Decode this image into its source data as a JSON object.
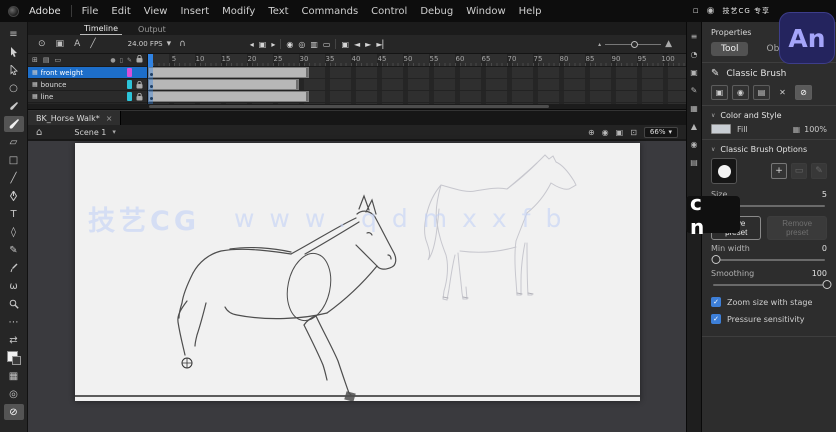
{
  "menubar": {
    "brand": "Adobe",
    "items": [
      "File",
      "Edit",
      "View",
      "Insert",
      "Modify",
      "Text",
      "Commands",
      "Control",
      "Debug",
      "Window",
      "Help"
    ]
  },
  "window": {
    "badge": "An",
    "corner_watermark": "技艺CG 专享"
  },
  "toolbar": {
    "tools": [
      {
        "n": "panel-handle-icon",
        "g": "≡",
        "interact": false
      },
      {
        "n": "selection-tool",
        "g": "@arrow"
      },
      {
        "n": "subselection-tool",
        "g": "@darrow"
      },
      {
        "n": "lasso-tool",
        "g": "○"
      },
      {
        "n": "fluid-brush-tool",
        "g": "@brush"
      },
      {
        "n": "classic-brush-tool",
        "g": "@brushbig",
        "active": true
      },
      {
        "n": "eraser-tool",
        "g": "▱"
      },
      {
        "n": "rectangle-tool",
        "g": "□"
      },
      {
        "n": "line-tool",
        "g": "╱"
      },
      {
        "n": "pen-tool",
        "g": "@pen"
      },
      {
        "n": "text-tool",
        "g": "T"
      },
      {
        "n": "paint-bucket-tool",
        "g": "◊"
      },
      {
        "n": "pencil-tool",
        "g": "✎"
      },
      {
        "n": "eyedropper-tool",
        "g": "@eyedrop"
      },
      {
        "n": "hand-tool",
        "g": "ω"
      },
      {
        "n": "zoom-tool",
        "g": "@zoomglass"
      },
      {
        "n": "more-tools-icon",
        "g": "⋯"
      },
      {
        "n": "swap-colors-icon",
        "g": "⇄"
      },
      {
        "n": "stroke-fill-swatches",
        "g": "@swatches"
      },
      {
        "n": "grid-snap-icon",
        "g": "▦"
      },
      {
        "n": "outline-mode-icon",
        "g": "◎"
      },
      {
        "n": "no-color-icon",
        "g": "⊘",
        "active": true
      }
    ]
  },
  "timeline": {
    "tabs": [
      {
        "label": "Timeline",
        "active": true
      },
      {
        "label": "Output",
        "active": false
      }
    ],
    "left_icons": [
      {
        "n": "show-layers-eye-icon",
        "g": "⊙"
      },
      {
        "n": "camera-layer-icon",
        "g": "▣"
      },
      {
        "n": "advanced-layers-icon",
        "g": "A"
      },
      {
        "n": "graph-editor-icon",
        "g": "╱"
      }
    ],
    "fps": "24.00 FPS",
    "fps_caret": "▾",
    "magnet": "∩",
    "playback": [
      {
        "n": "prev-frame-button",
        "g": "◂"
      },
      {
        "n": "current-frame-button",
        "g": "▣"
      },
      {
        "n": "next-frame-button",
        "g": "▸"
      },
      {
        "n": "sep",
        "g": "|"
      },
      {
        "n": "onion-skin-button",
        "g": "◉"
      },
      {
        "n": "onion-outlines-button",
        "g": "◎"
      },
      {
        "n": "edit-multiple-frames-button",
        "g": "▥"
      },
      {
        "n": "loop-button",
        "g": "▭"
      },
      {
        "n": "sep",
        "g": "|"
      },
      {
        "n": "camera-button",
        "g": "▣"
      },
      {
        "n": "step-back-button",
        "g": "◄"
      },
      {
        "n": "play-button",
        "g": "►"
      },
      {
        "n": "step-forward-button",
        "g": "►▏"
      }
    ],
    "layer_controls": [
      {
        "n": "new-layer-button",
        "g": "⊞"
      },
      {
        "n": "new-folder-button",
        "g": "▤"
      },
      {
        "n": "delete-layer-button",
        "g": "▭"
      }
    ],
    "column_icons": [
      {
        "n": "dot-column-icon",
        "g": "●"
      },
      {
        "n": "outline-column-icon",
        "g": "▯"
      },
      {
        "n": "highlight-column-icon",
        "g": "✎"
      },
      {
        "n": "lock-column-icon",
        "g": "@lock"
      }
    ],
    "ruler_numbers": [
      5,
      10,
      15,
      20,
      25,
      30,
      35,
      40,
      45,
      50,
      55,
      60,
      65,
      70,
      75,
      80,
      85,
      90,
      95,
      100
    ],
    "layers": [
      {
        "name": "front weight",
        "color": "#d94fd9",
        "selected": true,
        "locked": false,
        "span_frames": 31
      },
      {
        "name": "bounce",
        "color": "#2cc4d9",
        "selected": false,
        "locked": true,
        "span_frames": 29
      },
      {
        "name": "line",
        "color": "#2cc4d9",
        "selected": false,
        "locked": true,
        "span_frames": 31
      }
    ],
    "playhead_frame": 1
  },
  "document": {
    "tab_title": "BK_Horse Walk*",
    "close": "×",
    "scene": "Scene 1",
    "scene_caret": "▾",
    "zoom_level": "66%",
    "editbar_icons": [
      {
        "n": "center-frame-icon",
        "g": "⊕"
      },
      {
        "n": "camera-icon",
        "g": "◉"
      },
      {
        "n": "edit-symbols-icon",
        "g": "▣"
      },
      {
        "n": "fit-to-window-icon",
        "g": "⊡"
      }
    ]
  },
  "watermark": {
    "brand": "技艺CG",
    "url": "www.qdmxxfb",
    "suffix": "c n"
  },
  "dock": {
    "icons": [
      {
        "n": "align-panel-icon",
        "g": "≡"
      },
      {
        "n": "history-panel-icon",
        "g": "◔"
      },
      {
        "n": "library-panel-icon",
        "g": "▣"
      },
      {
        "n": "brushes-panel-icon",
        "g": "✎"
      },
      {
        "n": "swatches-panel-icon",
        "g": "▦"
      },
      {
        "n": "transform-panel-icon",
        "g": "▲"
      },
      {
        "n": "color-panel-icon",
        "g": "◉"
      },
      {
        "n": "components-panel-icon",
        "g": "▤"
      }
    ]
  },
  "properties": {
    "title": "Properties",
    "tabs": [
      {
        "label": "Tool",
        "active": true
      },
      {
        "label": "Object",
        "active": false
      }
    ],
    "tool_name": "Classic Brush",
    "option_buttons": [
      {
        "n": "object-drawing-button",
        "g": "▣"
      },
      {
        "n": "brush-library-button",
        "g": "◉"
      },
      {
        "n": "paint-mode-button",
        "g": "▤"
      },
      {
        "n": "pressure-button",
        "g": "✕",
        "noborder": true
      },
      {
        "n": "tilt-button",
        "g": "⊘",
        "active": true
      }
    ],
    "color_section": "Color and Style",
    "fill_label": "Fill",
    "fill_alpha": "100%",
    "brush_section": "Classic Brush Options",
    "size_label": "Size",
    "size_value": "5",
    "size_percent": 6,
    "save_preset": "Save preset",
    "remove_preset": "Remove preset",
    "minwidth_label": "Min width",
    "minwidth_value": "0",
    "minwidth_percent": 4,
    "smoothing_label": "Smoothing",
    "smoothing_value": "100",
    "smoothing_percent": 100,
    "checkboxes": [
      {
        "label": "Zoom size with stage",
        "checked": true
      },
      {
        "label": "Pressure sensitivity",
        "checked": true
      }
    ]
  }
}
